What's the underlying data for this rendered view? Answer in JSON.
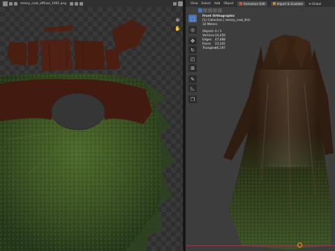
{
  "image_editor": {
    "filename": "messy_coat_diffuse_1001.png",
    "header_icons": [
      "image-editor-icon",
      "view-menu-icon",
      "image-menu-icon",
      "folder-icon",
      "duplicate-icon",
      "close-icon",
      "pin-icon",
      "display-channels-icon"
    ],
    "tools": [
      "zoom-icon",
      "hand-icon"
    ]
  },
  "viewport": {
    "menus": [
      "View",
      "Select",
      "Add",
      "Object"
    ],
    "mode_label": "Animation Edit",
    "mode_color": "#c15b38",
    "import_label": "Import & Scalable",
    "transform_label": "Global",
    "overlay": {
      "view_name": "Front Orthographic",
      "collection": "(1) Collection | messy_coat_thin",
      "scale": "10 Meters",
      "stats": [
        {
          "key": "Objects",
          "value": "0 / 1"
        },
        {
          "key": "Vertices",
          "value": "24,456"
        },
        {
          "key": "Edges",
          "value": "47,688"
        },
        {
          "key": "Faces",
          "value": "23,241"
        },
        {
          "key": "Triangles",
          "value": "46,197"
        }
      ]
    },
    "tools": [
      "select-box-icon",
      "cursor-icon",
      "move-icon",
      "rotate-icon",
      "scale-icon",
      "transform-icon",
      "annotate-icon",
      "measure-icon",
      "add-cube-icon"
    ]
  },
  "colors": {
    "accent": "#4772b3",
    "leather": "#4b1e12",
    "grass": "#3d5424",
    "floor_line": "#8e3a4a"
  }
}
